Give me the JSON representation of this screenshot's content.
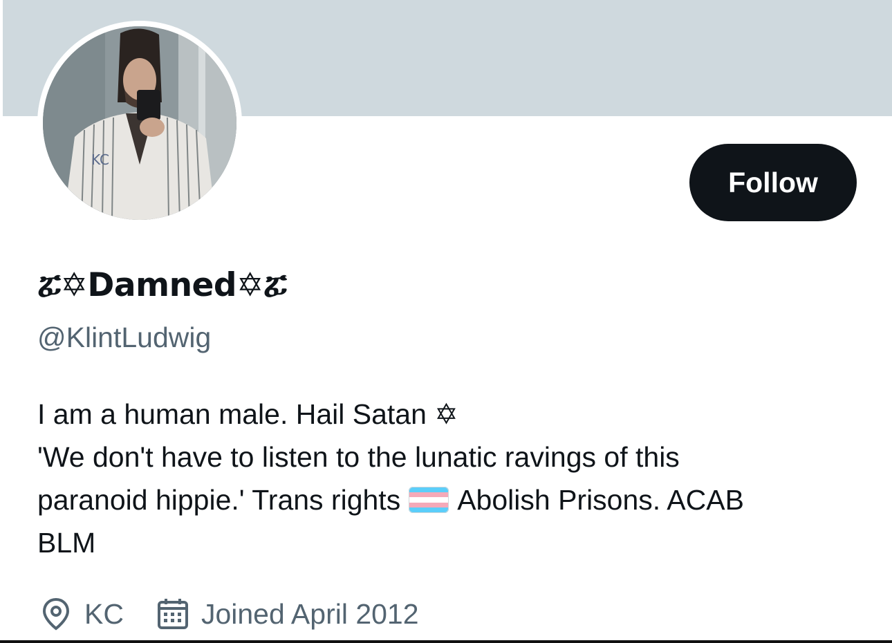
{
  "profile": {
    "display_name": "ፚ✡Damned✡ፚ",
    "handle": "@KlintLudwig",
    "follow_label": "Follow",
    "bio_lines": [
      "I am a human male. Hail Satan ✡",
      "'We don't have to listen to the lunatic ravings of this",
      "paranoid hippie.' Trans rights",
      "Abolish Prisons. ACAB",
      "BLM"
    ],
    "location": "KC",
    "joined": "Joined April 2012"
  },
  "icons": {
    "avatar": "profile-photo",
    "flag": "transgender-flag-icon",
    "location": "location-pin-icon",
    "calendar": "calendar-icon"
  },
  "colors": {
    "banner": "#cfd9de",
    "button_bg": "#0f1419",
    "button_text": "#ffffff",
    "secondary_text": "#536471",
    "flag_blue": "#5bcefa",
    "flag_pink": "#f5a9b8"
  }
}
